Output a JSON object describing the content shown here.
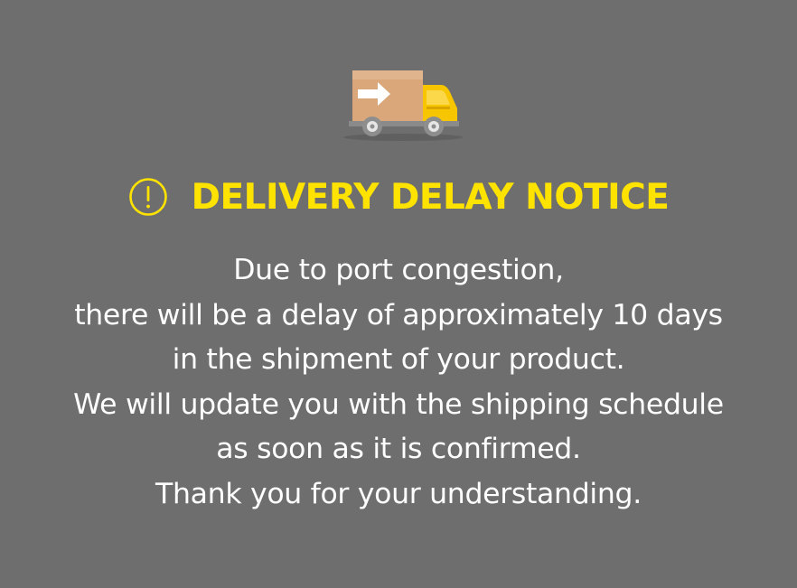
{
  "notice": {
    "icons": {
      "truck": "delivery-truck-icon",
      "alert": "exclamation-circle-icon"
    },
    "title": "DELIVERY DELAY NOTICE",
    "message_lines": [
      "Due to port congestion,",
      "there will be a delay of approximately 10 days",
      "in the shipment of your product.",
      "We will update you with the shipping schedule",
      "as soon as it is confirmed.",
      "Thank you for your understanding."
    ]
  },
  "colors": {
    "background": "#6e6e6e",
    "accent": "#ffe300",
    "text": "#ffffff",
    "box": "#d9a77a",
    "cab": "#f7c600"
  }
}
